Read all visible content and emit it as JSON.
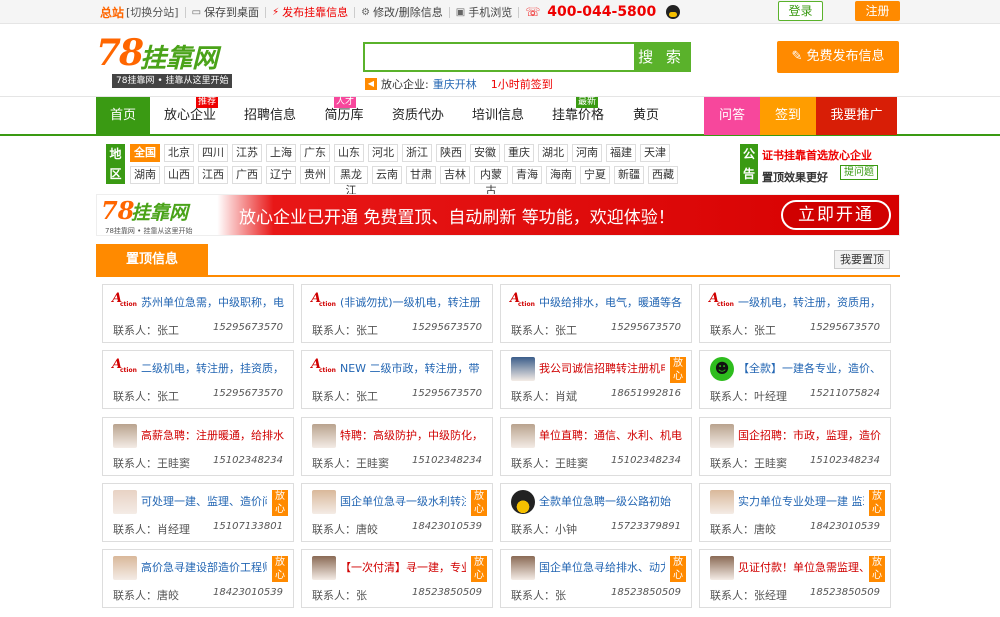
{
  "topbar": {
    "main_site": "总站",
    "switch_site": "[切换分站]",
    "links": [
      {
        "icon": "monitor-icon",
        "label": "保存到桌面",
        "red": false
      },
      {
        "icon": "lightning-icon",
        "label": "发布挂靠信息",
        "red": true
      },
      {
        "icon": "gear-icon",
        "label": "修改/删除信息",
        "red": false
      },
      {
        "icon": "phone-icon",
        "label": "手机浏览",
        "red": false
      }
    ],
    "hotline": "400-044-5800",
    "login": "登录",
    "register": "注册"
  },
  "header": {
    "logo_number": "78",
    "logo_name": "挂靠网",
    "logo_slogan": "78挂靠网 • 挂靠从这里开始",
    "search_placeholder": "",
    "search_button": "搜 索",
    "ticker_label": "放心企业:",
    "ticker_company": "重庆开林",
    "ticker_time": "1小时前签到",
    "free_post": "免费发布信息"
  },
  "nav": {
    "items": [
      {
        "label": "首页",
        "badge": ""
      },
      {
        "label": "放心企业",
        "badge": "推荐"
      },
      {
        "label": "招聘信息",
        "badge": ""
      },
      {
        "label": "简历库",
        "badge": "人才"
      },
      {
        "label": "资质代办",
        "badge": ""
      },
      {
        "label": "培训信息",
        "badge": ""
      },
      {
        "label": "挂靠价格",
        "badge": "最新"
      },
      {
        "label": "黄页",
        "badge": ""
      }
    ],
    "right": [
      {
        "label": "问答",
        "color": "#f7479c"
      },
      {
        "label": "签到",
        "color": "#ff9d00"
      },
      {
        "label": "我要推广",
        "color": "#d81e06"
      }
    ]
  },
  "regions": {
    "label": "地区",
    "row1": [
      "全国",
      "北京",
      "四川",
      "江苏",
      "上海",
      "广东",
      "山东",
      "河北",
      "浙江",
      "陕西",
      "安徽",
      "重庆",
      "湖北",
      "河南",
      "福建",
      "天津"
    ],
    "row2": [
      "湖南",
      "山西",
      "江西",
      "广西",
      "辽宁",
      "贵州",
      "黑龙江",
      "云南",
      "甘肃",
      "吉林",
      "内蒙古",
      "青海",
      "海南",
      "宁夏",
      "新疆",
      "西藏"
    ]
  },
  "notice": {
    "label": "公告",
    "line1": "证书挂靠首选放心企业",
    "line2": "置顶效果更好",
    "help": "提问题"
  },
  "banner": {
    "logo_number": "78",
    "logo_name": "挂靠网",
    "logo_slogan": "78挂靠网 • 挂靠从这里开始",
    "text": "放心企业已开通 免费置顶、自动刷新 等功能，欢迎体验！",
    "button": "立即开通"
  },
  "listing": {
    "tab": "置顶信息",
    "set_top": "我要置顶",
    "contact_prefix": "联系人：",
    "vip_label": "放心",
    "cards": [
      {
        "avatar": "action",
        "title": "苏州单位急需，中级职称，电",
        "red": false,
        "vip": false,
        "contact": "张工",
        "phone": "15295673570"
      },
      {
        "avatar": "action",
        "title": "(非诚勿扰)一级机电，转注册",
        "red": false,
        "vip": false,
        "contact": "张工",
        "phone": "15295673570"
      },
      {
        "avatar": "action",
        "title": "中级给排水，电气，暖通等各",
        "red": false,
        "vip": false,
        "contact": "张工",
        "phone": "15295673570"
      },
      {
        "avatar": "action",
        "title": "一级机电，转注册，资质用，",
        "red": false,
        "vip": false,
        "contact": "张工",
        "phone": "15295673570"
      },
      {
        "avatar": "action",
        "title": "二级机电，转注册，挂资质，",
        "red": false,
        "vip": false,
        "contact": "张工",
        "phone": "15295673570"
      },
      {
        "avatar": "action",
        "title": "NEW 二级市政，转注册，带",
        "red": false,
        "vip": false,
        "contact": "张工",
        "phone": "15295673570"
      },
      {
        "avatar": "company",
        "title": "我公司诚信招聘转注册机电专",
        "red": true,
        "vip": true,
        "contact": "肖斌",
        "phone": "18651992816"
      },
      {
        "avatar": "smiley",
        "title": "【全款】一建各专业，造价、",
        "red": false,
        "vip": false,
        "contact": "叶经理",
        "phone": "15211075824"
      },
      {
        "avatar": "man",
        "title": "高薪急聘：注册暖通，给排水",
        "red": true,
        "vip": false,
        "contact": "王眭窦",
        "phone": "15102348234"
      },
      {
        "avatar": "man",
        "title": "特聘：高级防护，中级防化，",
        "red": true,
        "vip": false,
        "contact": "王眭窦",
        "phone": "15102348234"
      },
      {
        "avatar": "man",
        "title": "单位直聘：通信、水利、机电",
        "red": true,
        "vip": false,
        "contact": "王眭窦",
        "phone": "15102348234"
      },
      {
        "avatar": "man",
        "title": "国企招聘：市政，监理，造价",
        "red": true,
        "vip": false,
        "contact": "王眭窦",
        "phone": "15102348234"
      },
      {
        "avatar": "girl",
        "title": "可处理一建、监理、造价问题",
        "red": false,
        "vip": true,
        "contact": "肖经理",
        "phone": "15107133801"
      },
      {
        "avatar": "photo",
        "title": "国企单位急寻一级水利转注资",
        "red": false,
        "vip": true,
        "contact": "唐皎",
        "phone": "18423010539"
      },
      {
        "avatar": "qq",
        "title": "全款单位急聘一级公路初始",
        "red": false,
        "vip": false,
        "contact": "小钟",
        "phone": "15723379891"
      },
      {
        "avatar": "photo",
        "title": "实力单位专业处理一建 监理",
        "red": false,
        "vip": true,
        "contact": "唐皎",
        "phone": "18423010539"
      },
      {
        "avatar": "photo",
        "title": "高价急寻建设部造价工程师初",
        "red": false,
        "vip": true,
        "contact": "唐皎",
        "phone": "18423010539"
      },
      {
        "avatar": "cartoon",
        "title": "【一次付清】寻一建，专业处",
        "red": true,
        "vip": true,
        "contact": "张",
        "phone": "18523850509"
      },
      {
        "avatar": "cartoon",
        "title": "国企单位急寻给排水、动力、",
        "red": false,
        "vip": true,
        "contact": "张",
        "phone": "18523850509"
      },
      {
        "avatar": "cartoon",
        "title": "见证付款！单位急需监理、造",
        "red": true,
        "vip": true,
        "contact": "张经理",
        "phone": "18523850509"
      }
    ]
  }
}
